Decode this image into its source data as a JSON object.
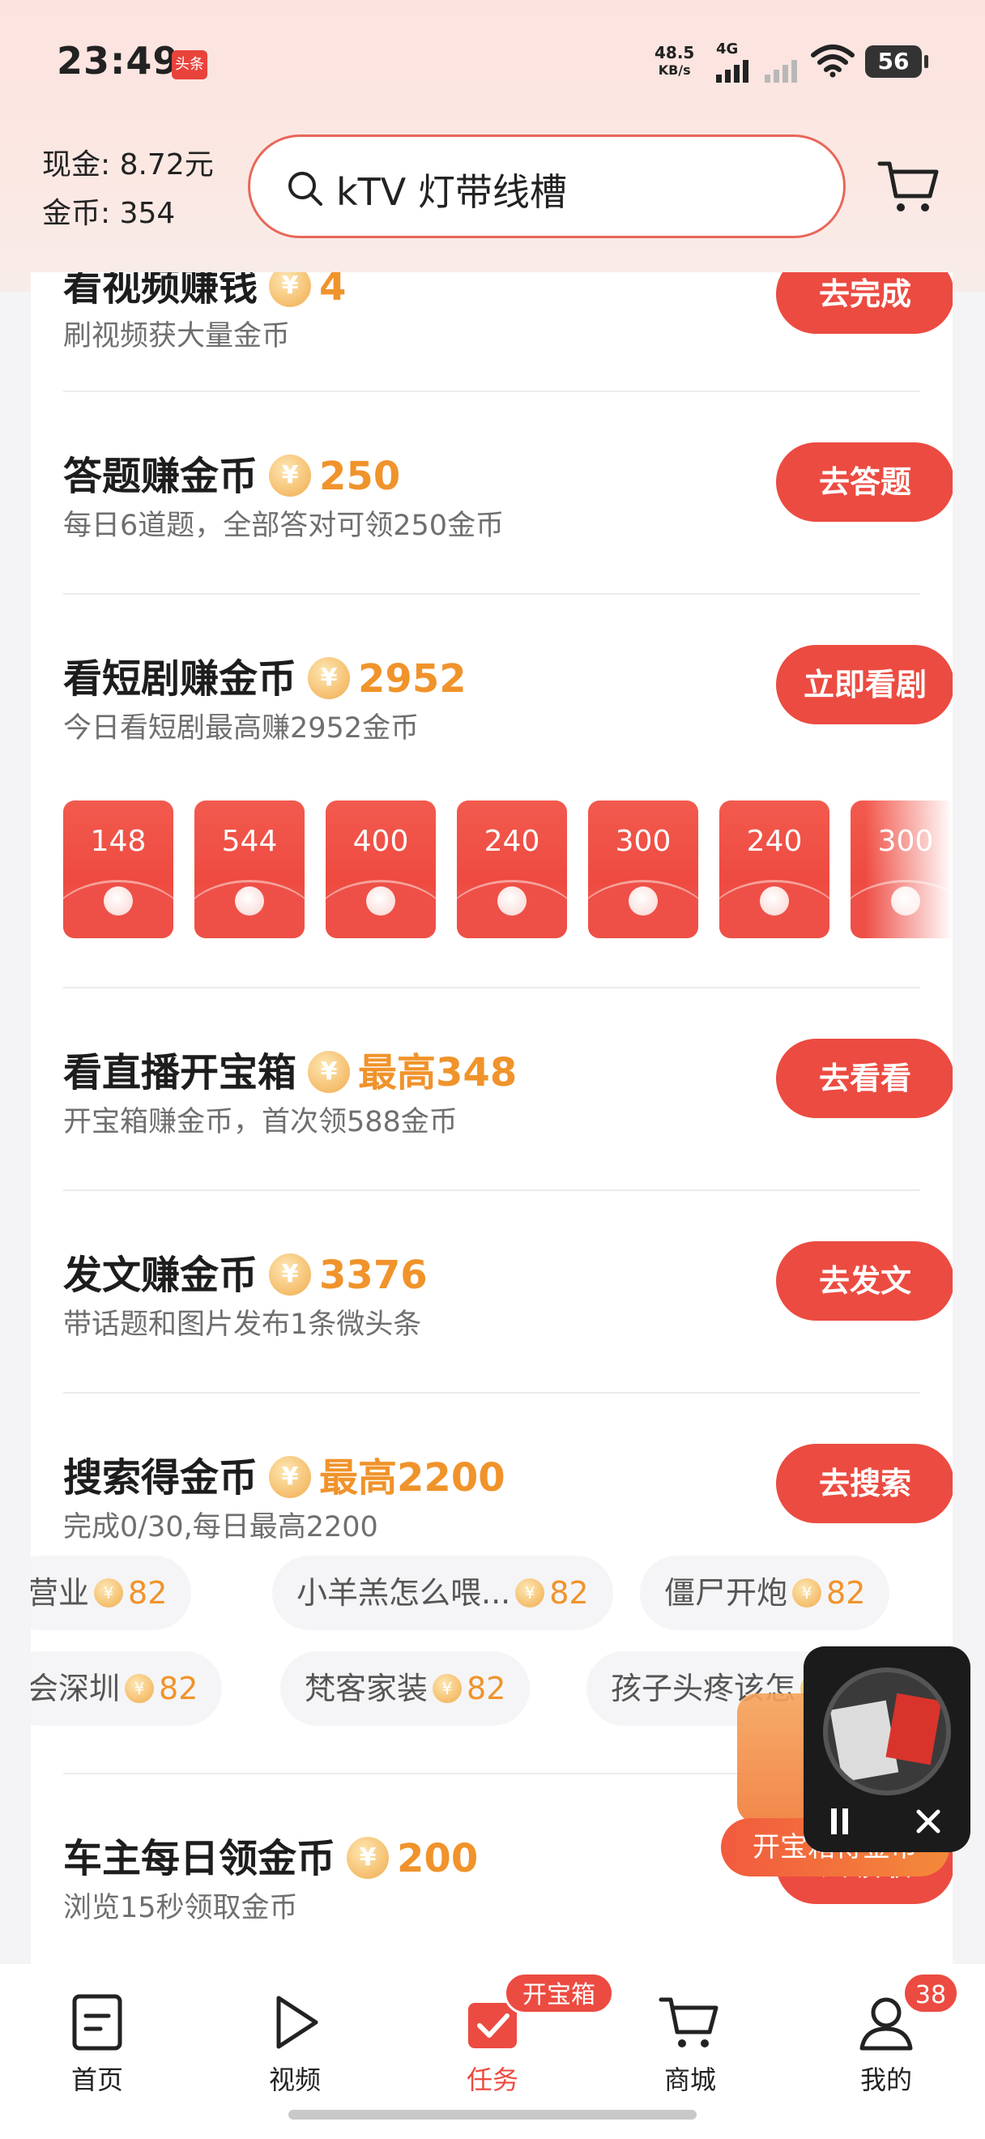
{
  "status_bar": {
    "time": "23:49",
    "app_badge": "头条",
    "net_speed_value": "48.5",
    "net_speed_unit": "KB/s",
    "network": "4G",
    "battery": "56"
  },
  "header": {
    "cash_label": "现金: 8.72元",
    "coins_label": "金币: 354",
    "search_query": "kTV 灯带线槽"
  },
  "tasks": [
    {
      "title": "看视频赚钱",
      "reward": "4",
      "subtitle": "刷视频获大量金币",
      "button": "去完成"
    },
    {
      "title": "答题赚金币",
      "reward": "250",
      "subtitle": "每日6道题，全部答对可领250金币",
      "button": "去答题"
    },
    {
      "title": "看短剧赚金币",
      "reward": "2952",
      "subtitle": "今日看短剧最高赚2952金币",
      "button": "立即看剧"
    },
    {
      "title": "看直播开宝箱",
      "reward": "最高348",
      "subtitle": "开宝箱赚金币，首次领588金币",
      "button": "去看看"
    },
    {
      "title": "发文赚金币",
      "reward": "3376",
      "subtitle": "带话题和图片发布1条微头条",
      "button": "去发文"
    },
    {
      "title": "搜索得金币",
      "reward": "最高2200",
      "subtitle": "完成0/30,每日最高2200",
      "button": "去搜索"
    },
    {
      "title": "车主每日领金币",
      "reward": "200",
      "subtitle": "浏览15秒领取金币",
      "button": "去领取"
    }
  ],
  "coin_symbol": "¥",
  "drama_packets": [
    "148",
    "544",
    "400",
    "240",
    "300",
    "240",
    "300"
  ],
  "search_chips_row1": [
    {
      "text": "营业",
      "coins": "82"
    },
    {
      "text": "小羊羔怎么喂...",
      "coins": "82"
    },
    {
      "text": "僵尸开炮",
      "coins": "82"
    }
  ],
  "search_chips_row2": [
    {
      "text": "会深圳",
      "coins": "82"
    },
    {
      "text": "梵客家装",
      "coins": "82"
    },
    {
      "text": "孩子头疼该怎",
      "coins": "82"
    }
  ],
  "floating": {
    "chest_label": "开宝箱得金币"
  },
  "bottom_nav": {
    "items": [
      {
        "label": "首页"
      },
      {
        "label": "视频"
      },
      {
        "label": "任务"
      },
      {
        "label": "商城"
      },
      {
        "label": "我的"
      }
    ],
    "task_badge": "开宝箱",
    "me_badge": "38"
  },
  "colors": {
    "accent": "#ec4b41",
    "reward": "#f0932b"
  }
}
